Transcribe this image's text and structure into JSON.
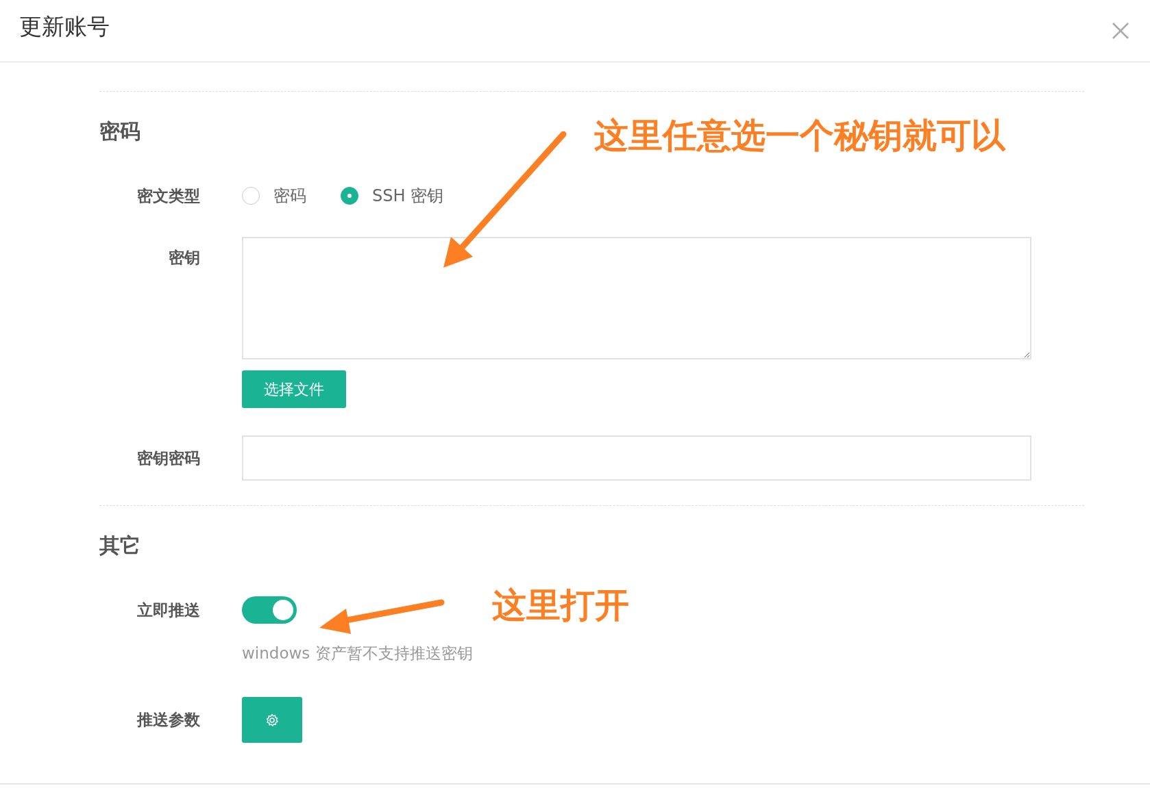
{
  "dialog": {
    "title": "更新账号"
  },
  "sections": [
    {
      "heading": "密码",
      "fields": [
        {
          "kind": "radio",
          "label": "密文类型",
          "options": [
            {
              "label": "密码",
              "selected": false
            },
            {
              "label": "SSH 密钥",
              "selected": true
            }
          ]
        },
        {
          "kind": "textarea",
          "label": "密钥",
          "button": "选择文件"
        },
        {
          "kind": "input",
          "label": "密钥密码"
        }
      ]
    },
    {
      "heading": "其它",
      "fields": [
        {
          "kind": "toggle",
          "label": "立即推送",
          "on": true,
          "hint": "windows 资产暂不支持推送密钥"
        },
        {
          "kind": "gear_button",
          "label": "推送参数"
        }
      ]
    }
  ],
  "annotations": [
    {
      "text": "这里任意选一个秘钥就可以"
    },
    {
      "text": "这里打开"
    }
  ]
}
